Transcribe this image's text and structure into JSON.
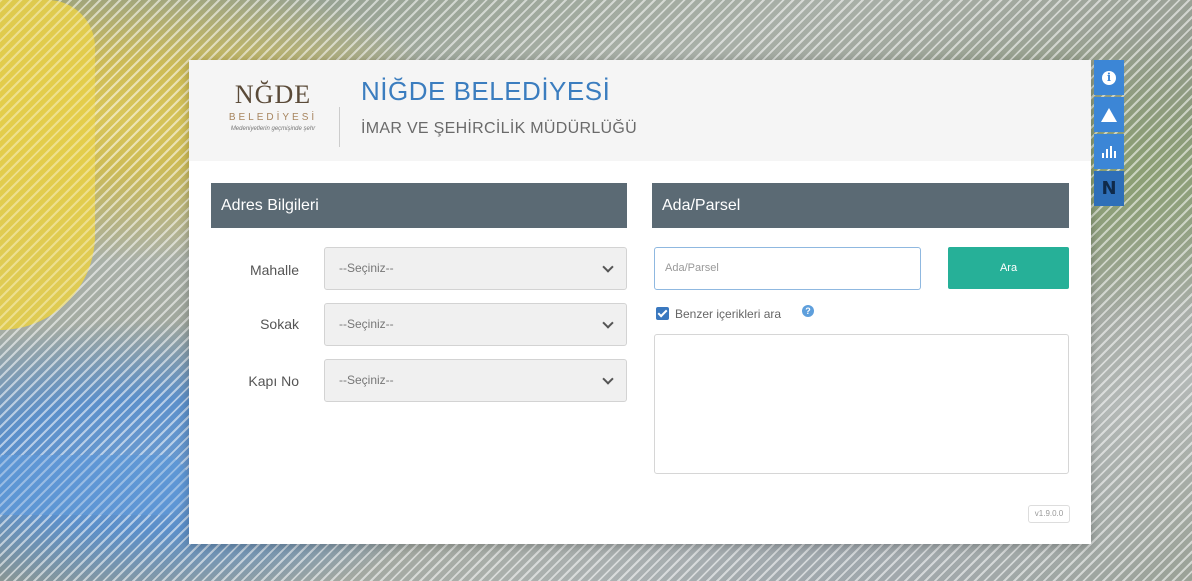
{
  "header": {
    "logo_word": "NĞDE",
    "logo_sub": "BELEDİYESİ",
    "logo_tag": "Medeniyetlerin geçmişinde şehr",
    "title": "NİĞDE BELEDİYESİ",
    "subtitle": "İMAR VE ŞEHİRCİLİK MÜDÜRLÜĞÜ"
  },
  "address_panel": {
    "heading": "Adres Bilgileri",
    "fields": [
      {
        "label": "Mahalle",
        "value": "--Seçiniz--"
      },
      {
        "label": "Sokak",
        "value": "--Seçiniz--"
      },
      {
        "label": "Kapı No",
        "value": "--Seçiniz--"
      }
    ]
  },
  "parcel_panel": {
    "heading": "Ada/Parsel",
    "input_placeholder": "Ada/Parsel",
    "search_button": "Ara",
    "similar_checkbox_label": "Benzer içerikleri ara",
    "similar_checked": true
  },
  "version": "v1.9.0.0",
  "side_toolbar": [
    {
      "icon": "info-icon"
    },
    {
      "icon": "warning-icon"
    },
    {
      "icon": "chart-icon"
    },
    {
      "icon": "app-logo-icon"
    }
  ],
  "colors": {
    "accent": "#3b7dbf",
    "panel_header": "#5b6a74",
    "search_button": "#26b098",
    "toolbar": "#3c86d6"
  }
}
